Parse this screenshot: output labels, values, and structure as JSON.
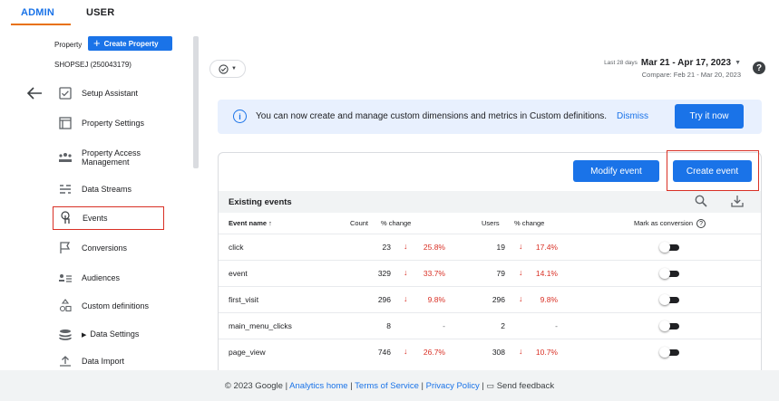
{
  "tabs": {
    "admin": "ADMIN",
    "user": "USER"
  },
  "property": {
    "label": "Property",
    "create_label": "Create Property",
    "id": "SHOPSEJ (250043179)"
  },
  "nav": [
    {
      "label": "Setup Assistant",
      "icon": "checkbox-icon"
    },
    {
      "label": "Property Settings",
      "icon": "window-icon"
    },
    {
      "label": "Property Access Management",
      "icon": "people-icon"
    },
    {
      "label": "Data Streams",
      "icon": "streams-icon"
    },
    {
      "label": "Events",
      "icon": "touch-icon"
    },
    {
      "label": "Conversions",
      "icon": "flag-icon"
    },
    {
      "label": "Audiences",
      "icon": "audience-icon"
    },
    {
      "label": "Custom definitions",
      "icon": "shapes-icon"
    },
    {
      "label": "Data Settings",
      "icon": "database-icon"
    },
    {
      "label": "Data Import",
      "icon": "upload-icon"
    }
  ],
  "date": {
    "last_days": "Last 28 days",
    "range": "Mar 21 - Apr 17, 2023",
    "compare": "Compare: Feb 21 - Mar 20, 2023"
  },
  "banner": {
    "text": "You can now create and manage custom dimensions and metrics in Custom definitions.",
    "dismiss": "Dismiss",
    "try_it": "Try it now"
  },
  "buttons": {
    "modify_event": "Modify event",
    "create_event": "Create event"
  },
  "table": {
    "title": "Existing events",
    "headers": {
      "event_name": "Event name ↑",
      "count": "Count",
      "count_change": "% change",
      "users": "Users",
      "users_change": "% change",
      "conversion": "Mark as conversion"
    },
    "rows": [
      {
        "name": "click",
        "count": "23",
        "count_change": "25.8%",
        "users": "19",
        "users_change": "17.4%"
      },
      {
        "name": "event",
        "count": "329",
        "count_change": "33.7%",
        "users": "79",
        "users_change": "14.1%"
      },
      {
        "name": "first_visit",
        "count": "296",
        "count_change": "9.8%",
        "users": "296",
        "users_change": "9.8%"
      },
      {
        "name": "main_menu_clicks",
        "count": "8",
        "count_change": "-",
        "users": "2",
        "users_change": "-"
      },
      {
        "name": "page_view",
        "count": "746",
        "count_change": "26.7%",
        "users": "308",
        "users_change": "10.7%"
      }
    ]
  },
  "footer": {
    "copyright": "© 2023 Google | ",
    "analytics_home": "Analytics home",
    "sep1": " | ",
    "terms": "Terms of Service",
    "sep2": " | ",
    "privacy": "Privacy Policy",
    "sep3": " | ",
    "feedback": "Send feedback"
  },
  "colors": {
    "accent": "#1a73e8",
    "highlight": "#d93025",
    "tab_underline": "#e8710a"
  }
}
